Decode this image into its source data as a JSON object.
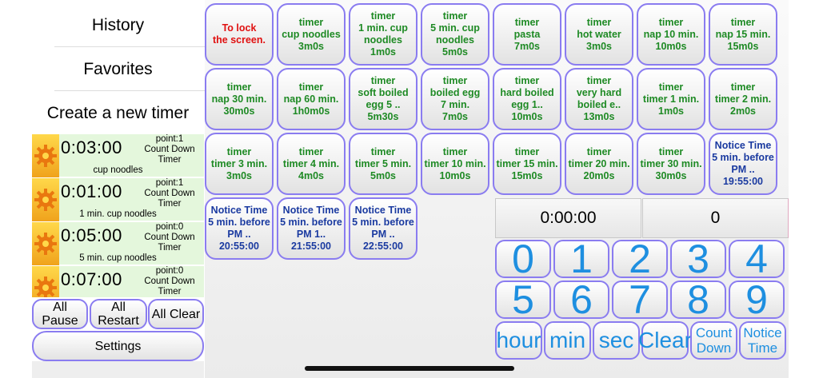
{
  "menu": {
    "history": "History",
    "favorites": "Favorites",
    "create": "Create a new timer"
  },
  "running_timers": [
    {
      "time": "0:03:00",
      "point": "point:1",
      "mode": "Count Down",
      "kind": "Timer",
      "label": "cup noodles"
    },
    {
      "time": "0:01:00",
      "point": "point:1",
      "mode": "Count Down",
      "kind": "Timer",
      "label": "1 min. cup noodles"
    },
    {
      "time": "0:05:00",
      "point": "point:0",
      "mode": "Count Down",
      "kind": "Timer",
      "label": "5 min. cup noodles"
    },
    {
      "time": "0:07:00",
      "point": "point:0",
      "mode": "Count Down",
      "kind": "Timer",
      "label": ""
    }
  ],
  "controls": {
    "all_pause": "All Pause",
    "all_restart": "All\nRestart",
    "all_clear": "All Clear",
    "settings": "Settings"
  },
  "presets": [
    {
      "text": "To lock\nthe screen.",
      "color": "red"
    },
    {
      "text": "timer\ncup noodles\n3m0s",
      "color": "green"
    },
    {
      "text": "timer\n1 min. cup\nnoodles\n1m0s",
      "color": "green"
    },
    {
      "text": "timer\n5 min. cup\nnoodles\n5m0s",
      "color": "green"
    },
    {
      "text": "timer\npasta\n7m0s",
      "color": "green"
    },
    {
      "text": "timer\nhot water\n3m0s",
      "color": "green"
    },
    {
      "text": "timer\nnap 10 min.\n10m0s",
      "color": "green"
    },
    {
      "text": "timer\nnap 15 min.\n15m0s",
      "color": "green"
    },
    {
      "text": "timer\nnap 30 min.\n30m0s",
      "color": "green"
    },
    {
      "text": "timer\nnap 60 min.\n1h0m0s",
      "color": "green"
    },
    {
      "text": "timer\nsoft boiled\negg 5 ..\n5m30s",
      "color": "green"
    },
    {
      "text": "timer\nboiled egg\n7 min.\n7m0s",
      "color": "green"
    },
    {
      "text": "timer\nhard boiled\negg 1..\n10m0s",
      "color": "green"
    },
    {
      "text": "timer\nvery hard\nboiled e..\n13m0s",
      "color": "green"
    },
    {
      "text": "timer\ntimer 1 min.\n1m0s",
      "color": "green"
    },
    {
      "text": "timer\ntimer 2 min.\n2m0s",
      "color": "green"
    },
    {
      "text": "timer\ntimer 3 min.\n3m0s",
      "color": "green"
    },
    {
      "text": "timer\ntimer 4 min.\n4m0s",
      "color": "green"
    },
    {
      "text": "timer\ntimer 5 min.\n5m0s",
      "color": "green"
    },
    {
      "text": "timer\ntimer 10 min.\n10m0s",
      "color": "green"
    },
    {
      "text": "timer\ntimer 15 min.\n15m0s",
      "color": "green"
    },
    {
      "text": "timer\ntimer 20 min.\n20m0s",
      "color": "green"
    },
    {
      "text": "timer\ntimer 30 min.\n30m0s",
      "color": "green"
    },
    {
      "text": "Notice Time\n5 min. before\nPM ..\n19:55:00",
      "color": "blue"
    },
    {
      "text": "Notice Time\n5 min. before\nPM ..\n20:55:00",
      "color": "blue"
    },
    {
      "text": "Notice Time\n5 min. before\nPM 1..\n21:55:00",
      "color": "blue"
    },
    {
      "text": "Notice Time\n5 min. before\nPM ..\n22:55:00",
      "color": "blue"
    }
  ],
  "display": {
    "time": "0:00:00",
    "count": "0"
  },
  "keypad": {
    "digits": [
      "0",
      "1",
      "2",
      "3",
      "4",
      "5",
      "6",
      "7",
      "8",
      "9"
    ],
    "functions": [
      "hour",
      "min",
      "sec",
      "Clear",
      "Count\nDown",
      "Notice\nTime"
    ]
  },
  "colors": {
    "accent_border": "#8a7cf0",
    "preset_green": "#1e8a24",
    "preset_red": "#e01010",
    "preset_blue": "#1a3aa0",
    "key_blue": "#1e8fe0",
    "timer_row_bg": "#e4f7dc"
  },
  "icons": {
    "timer_row": "gear-icon"
  }
}
